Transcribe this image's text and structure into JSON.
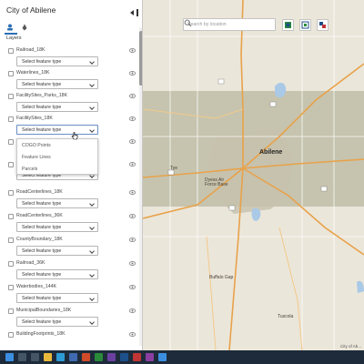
{
  "panel": {
    "title": "City of Abilene",
    "layers_label": "Layers",
    "layers": [
      {
        "name": "Railroad_18K",
        "select": "Select feature type"
      },
      {
        "name": "Waterlines_18K",
        "select": "Select feature type"
      },
      {
        "name": "FacilitySites_Parks_18K",
        "select": "Select feature type"
      },
      {
        "name": "FacilitySites_18K",
        "select": "Select feature type"
      },
      {
        "name": "",
        "select": ""
      },
      {
        "name": "",
        "select": "Select feature type"
      },
      {
        "name": "RoadCenterlines_18K",
        "select": "Select feature type"
      },
      {
        "name": "RoadCenterlines_36K",
        "select": "Select feature type"
      },
      {
        "name": "CountyBoundary_18K",
        "select": "Select feature type"
      },
      {
        "name": "Railroad_36K",
        "select": "Select feature type"
      },
      {
        "name": "Waterbodies_144K",
        "select": "Select feature type"
      },
      {
        "name": "MunicipalBoundaries_18K",
        "select": "Select feature type"
      },
      {
        "name": "BuildingFootprints_18K",
        "select": ""
      }
    ],
    "dropdown_options": [
      "COGO Points",
      "Feature Lines",
      "Parcels"
    ]
  },
  "map": {
    "search_placeholder": "Search by location",
    "labels": {
      "abilene": "Abilene",
      "tye": "Tye",
      "dyess": "Dyess Air Force Base",
      "buffalo_gap": "Buffalo Gap",
      "tuscola": "Tuscola",
      "attribution": "City of Ab..."
    },
    "colors": {
      "highlight": "#b9b8a0",
      "highway": "#e8a24a",
      "water": "#a9c9e6",
      "urban": "#d8cfc0"
    },
    "tool_icons": [
      "fullscreen-icon",
      "zoom-extent-icon",
      "layers-tool-icon"
    ]
  },
  "taskbar": {
    "icons": [
      "windows-start-icon",
      "search-icon",
      "task-view-icon",
      "file-explorer-icon",
      "edge-icon",
      "app-icon",
      "app-icon",
      "app-icon",
      "app-icon",
      "app-icon",
      "app-icon",
      "app-icon",
      "app-icon"
    ]
  }
}
